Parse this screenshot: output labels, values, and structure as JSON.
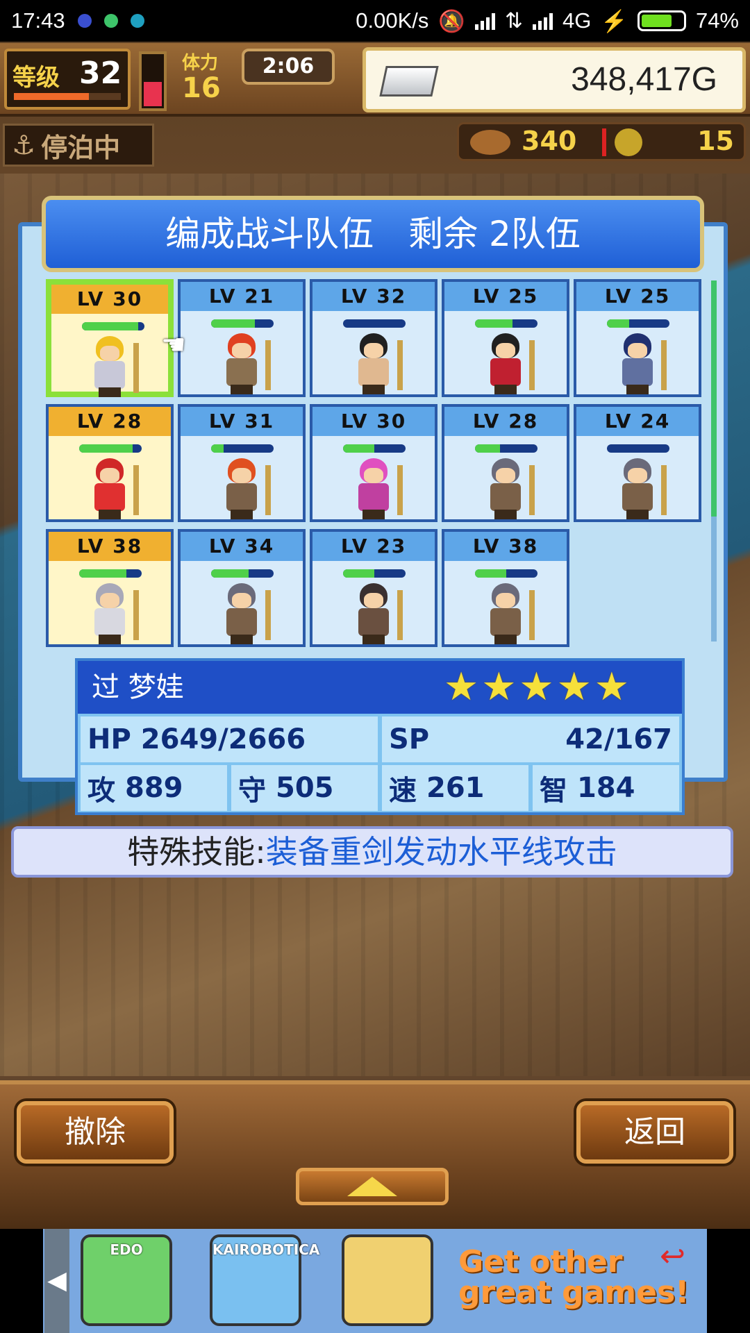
{
  "status_bar": {
    "time": "17:43",
    "net_speed": "0.00K/s",
    "network": "4G",
    "battery": "74%"
  },
  "hud": {
    "level_label": "等级",
    "level": "32",
    "stamina_label": "体力",
    "stamina": "16",
    "timer": "2:06",
    "gold": "348,417G",
    "status": "停泊中",
    "food": "340",
    "coins": "15"
  },
  "panel": {
    "title": "编成战斗队伍　剩余 2队伍"
  },
  "members": [
    {
      "lv": "LV 30",
      "gold": true,
      "selected": true,
      "hp": 0.9,
      "hair": "#f0c020",
      "outfit": "#c8c8d8"
    },
    {
      "lv": "LV 21",
      "gold": false,
      "selected": false,
      "hp": 0.7,
      "hair": "#e04020",
      "outfit": "#8a7050"
    },
    {
      "lv": "LV 32",
      "gold": false,
      "selected": false,
      "hp": 0.0,
      "hair": "#202020",
      "outfit": "#e0b890"
    },
    {
      "lv": "LV 25",
      "gold": false,
      "selected": false,
      "hp": 0.6,
      "hair": "#202020",
      "outfit": "#c02030"
    },
    {
      "lv": "LV 25",
      "gold": false,
      "selected": false,
      "hp": 0.35,
      "hair": "#203070",
      "outfit": "#6070a0"
    },
    {
      "lv": "LV 28",
      "gold": true,
      "selected": false,
      "hp": 0.85,
      "hair": "#d02828",
      "outfit": "#e03030"
    },
    {
      "lv": "LV 31",
      "gold": false,
      "selected": false,
      "hp": 0.2,
      "hair": "#e05020",
      "outfit": "#7a6048"
    },
    {
      "lv": "LV 30",
      "gold": false,
      "selected": false,
      "hp": 0.5,
      "hair": "#e050c0",
      "outfit": "#c040a0"
    },
    {
      "lv": "LV 28",
      "gold": false,
      "selected": false,
      "hp": 0.4,
      "hair": "#6a6a7a",
      "outfit": "#7a6048"
    },
    {
      "lv": "LV 24",
      "gold": false,
      "selected": false,
      "hp": 0.0,
      "hair": "#6a6a7a",
      "outfit": "#7a6048"
    },
    {
      "lv": "LV 38",
      "gold": true,
      "selected": false,
      "hp": 0.75,
      "hair": "#a8a8b8",
      "outfit": "#d8d8e0"
    },
    {
      "lv": "LV 34",
      "gold": false,
      "selected": false,
      "hp": 0.6,
      "hair": "#6a6a7a",
      "outfit": "#7a6048"
    },
    {
      "lv": "LV 23",
      "gold": false,
      "selected": false,
      "hp": 0.5,
      "hair": "#3a3030",
      "outfit": "#6a5040"
    },
    {
      "lv": "LV 38",
      "gold": false,
      "selected": false,
      "hp": 0.5,
      "hair": "#6a6a7a",
      "outfit": "#7a6048"
    }
  ],
  "selected_member": {
    "name": "过 梦娃",
    "stars": "★★★★★",
    "hp_label": "HP",
    "hp": "2649/2666",
    "sp_label": "SP",
    "sp": "42/167",
    "atk_label": "攻",
    "atk": "889",
    "def_label": "守",
    "def": "505",
    "spd_label": "速",
    "spd": "261",
    "int_label": "智",
    "int": "184"
  },
  "skill": {
    "label": "特殊技能:",
    "value": "装备重剑发动水平线攻击"
  },
  "buttons": {
    "remove": "撤除",
    "back": "返回"
  },
  "ad": {
    "app1": "EDO",
    "app2": "KAIROBOTICA",
    "text_line1": "Get other",
    "text_line2": "great games!"
  }
}
